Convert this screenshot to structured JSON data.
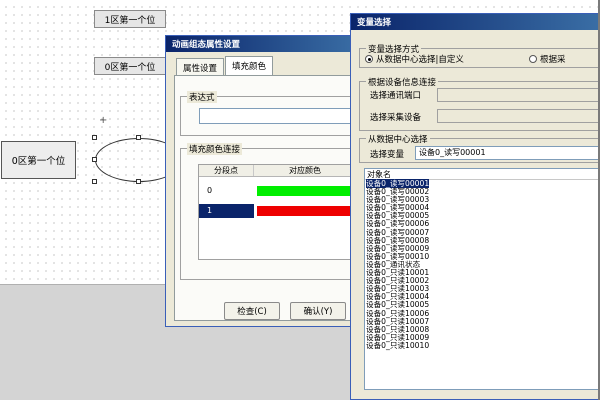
{
  "canvas": {
    "label_top": "1区第一个位",
    "label_middle": "0区第一个位",
    "label_left": "0区第一个位",
    "cursor_glyph": "+"
  },
  "property_dialog": {
    "title": "动画组态属性设置",
    "tabs": [
      "属性设置",
      "填充颜色"
    ],
    "expression_group": "表达式",
    "expression_value": "",
    "fill_group": "填充颜色连接",
    "grid_headers": [
      "分段点",
      "对应颜色"
    ],
    "grid_rows": [
      {
        "point": "0",
        "color": "#00ee00"
      },
      {
        "point": "1",
        "color": "#ee0000"
      }
    ],
    "buttons": {
      "check": "检查(C)",
      "ok": "确认(Y)"
    }
  },
  "variable_dialog": {
    "title": "变量选择",
    "mode_group": "变量选择方式",
    "mode_options": [
      {
        "label": "从数据中心选择|自定义",
        "checked": true
      },
      {
        "label": "根据采",
        "checked": false
      }
    ],
    "device_group": "根据设备信息连接",
    "device_port_label": "选择通讯端口",
    "device_collect_label": "选择采集设备",
    "datacenter_group": "从数据中心选择",
    "select_var_label": "选择变量",
    "select_var_value": "设备0_读写00001",
    "list_header": "对象名",
    "objects": [
      "设备0_读写00001",
      "设备0_读写00002",
      "设备0_读写00003",
      "设备0_读写00004",
      "设备0_读写00005",
      "设备0_读写00006",
      "设备0_读写00007",
      "设备0_读写00008",
      "设备0_读写00009",
      "设备0_读写00010",
      "设备0_通讯状态",
      "设备0_只读10001",
      "设备0_只读10002",
      "设备0_只读10003",
      "设备0_只读10004",
      "设备0_只读10005",
      "设备0_只读10006",
      "设备0_只读10007",
      "设备0_只读10008",
      "设备0_只读10009",
      "设备0_只读10010"
    ],
    "selected_index": 0
  }
}
